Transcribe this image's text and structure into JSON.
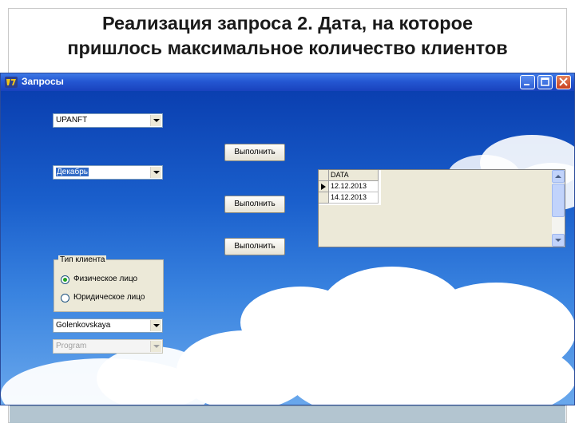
{
  "slide": {
    "title_line1": "Реализация запроса 2. Дата, на которое",
    "title_line2": "пришлось максимальное количество клиентов"
  },
  "window": {
    "title": "Запросы"
  },
  "form": {
    "combo_top": {
      "value": "UPANFT"
    },
    "combo_month": {
      "value": "Декабрь"
    },
    "execute_button_1": "Выполнить",
    "execute_button_2": "Выполнить",
    "execute_button_3": "Выполнить",
    "client_type": {
      "label": "Тип клиента",
      "options": [
        "Физическое лицо",
        "Юридическое лицо"
      ],
      "selected": "Физическое лицо"
    },
    "combo_name": {
      "value": "Golenkovskaya"
    },
    "combo_program": {
      "value": "Program"
    }
  },
  "grid": {
    "column": "DATA",
    "rows": [
      "12.12.2013",
      "14.12.2013"
    ]
  },
  "colors": {
    "titlebar": "#2457d2",
    "button_face": "#ece9d8",
    "selection": "#316ac5"
  },
  "icons": {
    "app": "delphi-app-icon",
    "minimize": "minimize-icon",
    "maximize": "maximize-icon",
    "close": "close-icon"
  }
}
